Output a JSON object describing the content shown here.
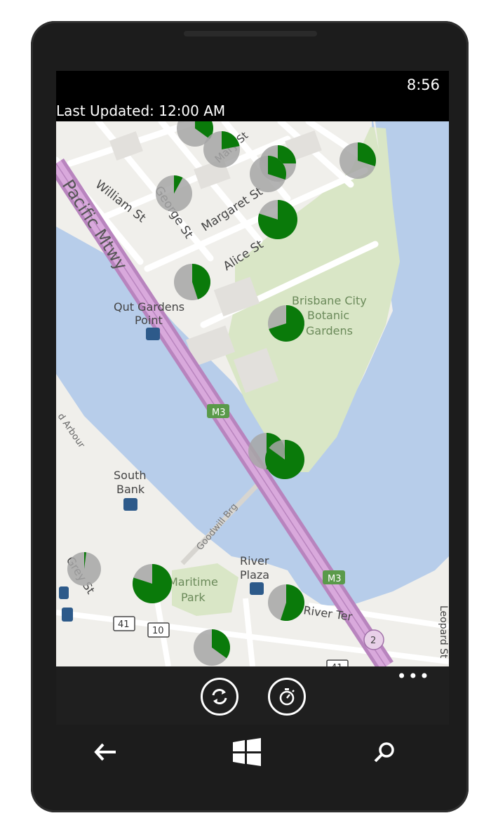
{
  "status_bar": {
    "time": "8:56"
  },
  "header": {
    "last_updated": "Last Updated: 12:00 AM"
  },
  "map": {
    "labels": {
      "pacific_mtwy": "Pacific Mtwy",
      "william_st": "William St",
      "george_st": "George St",
      "margaret_st": "Margaret St",
      "alice_st": "Alice St",
      "mary_st": "Mary St",
      "qut_gardens_1": "Qut Gardens",
      "qut_gardens_2": "Point",
      "botanic_1": "Brisbane City",
      "botanic_2": "Botanic",
      "botanic_3": "Gardens",
      "south_bank_1": "South",
      "south_bank_2": "Bank",
      "goodwill_brg": "Goodwill Brg",
      "river_plaza_1": "River",
      "river_plaza_2": "Plaza",
      "maritime_park_1": "Maritime",
      "maritime_park_2": "Park",
      "river_ter": "River Ter",
      "grey_st": "Grey St",
      "leopard_st": "Leopard St",
      "harbour": "d Arbour",
      "m3_top": "M3",
      "m3_bottom": "M3",
      "route_41": "41",
      "route_10": "10",
      "route_2": "2",
      "route_41b": "41"
    },
    "markers_fraction": [
      {
        "id": "m1",
        "fill": 0.35
      },
      {
        "id": "m2",
        "fill": 0.25
      },
      {
        "id": "m3",
        "fill": 0.08
      },
      {
        "id": "m4",
        "fill": 0.3
      },
      {
        "id": "m5",
        "fill": 0.22
      },
      {
        "id": "m6",
        "fill": 0.3
      },
      {
        "id": "m7",
        "fill": 0.8
      },
      {
        "id": "m8",
        "fill": 0.45
      },
      {
        "id": "m9",
        "fill": 0.7
      },
      {
        "id": "m10",
        "fill": 0.5
      },
      {
        "id": "m11",
        "fill": 0.85
      },
      {
        "id": "m12",
        "fill": 0.02
      },
      {
        "id": "m13",
        "fill": 0.8
      },
      {
        "id": "m14",
        "fill": 0.55
      },
      {
        "id": "m15",
        "fill": 0.35
      }
    ],
    "colors": {
      "water": "#b7cdea",
      "land": "#f0efeb",
      "park": "#d9e6c6",
      "motorway": "#c98fcf",
      "pie_fill": "#0a7a0a",
      "pie_base": "#a6a6a6"
    }
  },
  "app_bar": {
    "refresh_icon": "refresh-icon",
    "timer_icon": "timer-icon",
    "more": "•••"
  },
  "nav": {
    "back_icon": "back-arrow-icon",
    "start_icon": "windows-logo-icon",
    "search_icon": "search-icon"
  }
}
